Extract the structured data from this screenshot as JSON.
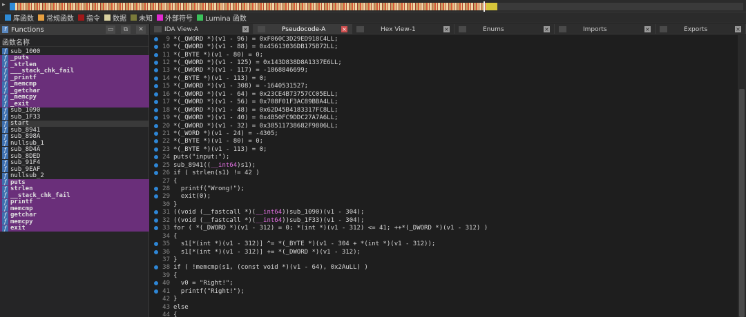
{
  "legend": [
    {
      "label": "库函数",
      "color": "#2e8bd6"
    },
    {
      "label": "常规函数",
      "color": "#e8a040"
    },
    {
      "label": "指令",
      "color": "#a01818"
    },
    {
      "label": "数据",
      "color": "#d8d0a0"
    },
    {
      "label": "未知",
      "color": "#7a7a3a"
    },
    {
      "label": "外部符号",
      "color": "#e02ad0"
    },
    {
      "label": "Lumina 函数",
      "color": "#3ac05a"
    }
  ],
  "functions_panel": {
    "title": "Functions",
    "column_header": "函数名称",
    "items": [
      {
        "name": "sub_1000",
        "kind": "regular"
      },
      {
        "name": "_puts",
        "kind": "lib"
      },
      {
        "name": "_strlen",
        "kind": "lib"
      },
      {
        "name": "___stack_chk_fail",
        "kind": "lib"
      },
      {
        "name": "_printf",
        "kind": "lib"
      },
      {
        "name": "_memcmp",
        "kind": "lib"
      },
      {
        "name": "_getchar",
        "kind": "lib"
      },
      {
        "name": "_memcpy",
        "kind": "lib"
      },
      {
        "name": "_exit",
        "kind": "lib"
      },
      {
        "name": "sub_1090",
        "kind": "regular"
      },
      {
        "name": "sub_1F33",
        "kind": "regular"
      },
      {
        "name": "start",
        "kind": "selected"
      },
      {
        "name": "sub_8941",
        "kind": "regular"
      },
      {
        "name": "sub_898A",
        "kind": "regular"
      },
      {
        "name": "nullsub_1",
        "kind": "regular"
      },
      {
        "name": "sub_8D4A",
        "kind": "regular"
      },
      {
        "name": "sub_8DED",
        "kind": "regular"
      },
      {
        "name": "sub_91F4",
        "kind": "regular"
      },
      {
        "name": "sub_9EAF",
        "kind": "regular"
      },
      {
        "name": "nullsub_2",
        "kind": "regular"
      },
      {
        "name": "puts",
        "kind": "extern"
      },
      {
        "name": "strlen",
        "kind": "extern"
      },
      {
        "name": "__stack_chk_fail",
        "kind": "extern"
      },
      {
        "name": "printf",
        "kind": "extern"
      },
      {
        "name": "memcmp",
        "kind": "extern"
      },
      {
        "name": "getchar",
        "kind": "extern"
      },
      {
        "name": "memcpy",
        "kind": "extern"
      },
      {
        "name": "exit",
        "kind": "extern"
      }
    ]
  },
  "tabs": [
    {
      "label": "IDA View-A",
      "icon": "ida-view-icon",
      "active": false
    },
    {
      "label": "Pseudocode-A",
      "icon": "pseudocode-icon",
      "active": true
    },
    {
      "label": "Hex View-1",
      "icon": "hex-view-icon",
      "active": false
    },
    {
      "label": "Enums",
      "icon": "enums-icon",
      "active": false
    },
    {
      "label": "Imports",
      "icon": "imports-icon",
      "active": false
    },
    {
      "label": "Exports",
      "icon": "exports-icon",
      "active": false
    }
  ],
  "code_lines": [
    {
      "n": "9",
      "dot": true,
      "text": "*(_QWORD *)(v1 - 96) = 0xF060C3D29ED918C4LL;"
    },
    {
      "n": "10",
      "dot": true,
      "text": "*(_QWORD *)(v1 - 88) = 0x45613036DB175B72LL;"
    },
    {
      "n": "11",
      "dot": true,
      "text": "*(_BYTE *)(v1 - 80) = 0;"
    },
    {
      "n": "12",
      "dot": true,
      "text": "*(_QWORD *)(v1 - 125) = 0x143D838D8A1337E6LL;"
    },
    {
      "n": "13",
      "dot": true,
      "text": "*(_DWORD *)(v1 - 117) = -1868846699;"
    },
    {
      "n": "14",
      "dot": true,
      "text": "*(_BYTE *)(v1 - 113) = 0;"
    },
    {
      "n": "15",
      "dot": true,
      "text": "*(_DWORD *)(v1 - 308) = -1640531527;"
    },
    {
      "n": "16",
      "dot": true,
      "text": "*(_QWORD *)(v1 - 64) = 0x23CE4B73757CC05ELL;"
    },
    {
      "n": "17",
      "dot": true,
      "text": "*(_QWORD *)(v1 - 56) = 0x708F01F3AC89BBA4LL;"
    },
    {
      "n": "18",
      "dot": true,
      "text": "*(_QWORD *)(v1 - 48) = 0x62D45B4183317FC8LL;"
    },
    {
      "n": "19",
      "dot": true,
      "text": "*(_QWORD *)(v1 - 40) = 0x4B50FC9DDC27A7A6LL;"
    },
    {
      "n": "20",
      "dot": true,
      "text": "*(_QWORD *)(v1 - 32) = 0x38511738682F9806LL;"
    },
    {
      "n": "21",
      "dot": true,
      "text": "*(_WORD *)(v1 - 24) = -4305;"
    },
    {
      "n": "22",
      "dot": true,
      "text": "*(_BYTE *)(v1 - 80) = 0;"
    },
    {
      "n": "23",
      "dot": true,
      "text": "*(_BYTE *)(v1 - 113) = 0;"
    },
    {
      "n": "24",
      "dot": true,
      "text": "puts(\"input:\");"
    },
    {
      "n": "25",
      "dot": true,
      "text": "sub_8941((__int64)s1);"
    },
    {
      "n": "26",
      "dot": true,
      "text": "if ( strlen(s1) != 42 )"
    },
    {
      "n": "27",
      "dot": false,
      "text": "{"
    },
    {
      "n": "28",
      "dot": true,
      "text": "  printf(\"Wrong!\");"
    },
    {
      "n": "29",
      "dot": true,
      "text": "  exit(0);"
    },
    {
      "n": "30",
      "dot": false,
      "text": "}"
    },
    {
      "n": "31",
      "dot": true,
      "text": "((void (__fastcall *)(__int64))sub_1090)(v1 - 304);"
    },
    {
      "n": "32",
      "dot": true,
      "text": "((void (__fastcall *)(__int64))sub_1F33)(v1 - 304);"
    },
    {
      "n": "33",
      "dot": true,
      "text": "for ( *(_DWORD *)(v1 - 312) = 0; *(int *)(v1 - 312) <= 41; ++*(_DWORD *)(v1 - 312) )"
    },
    {
      "n": "34",
      "dot": false,
      "text": "{"
    },
    {
      "n": "35",
      "dot": true,
      "text": "  s1[*(int *)(v1 - 312)] ^= *(_BYTE *)(v1 - 304 + *(int *)(v1 - 312));"
    },
    {
      "n": "36",
      "dot": true,
      "text": "  s1[*(int *)(v1 - 312)] += *(_DWORD *)(v1 - 312);"
    },
    {
      "n": "37",
      "dot": false,
      "text": "}"
    },
    {
      "n": "38",
      "dot": true,
      "text": "if ( !memcmp(s1, (const void *)(v1 - 64), 0x2AuLL) )"
    },
    {
      "n": "39",
      "dot": false,
      "text": "{"
    },
    {
      "n": "40",
      "dot": true,
      "text": "  v0 = \"Right!\";"
    },
    {
      "n": "41",
      "dot": true,
      "text": "  printf(\"Right!\");"
    },
    {
      "n": "42",
      "dot": false,
      "text": "}"
    },
    {
      "n": "43",
      "dot": false,
      "text": "else"
    },
    {
      "n": "44",
      "dot": false,
      "text": "{"
    }
  ],
  "colors": {
    "lib_function_bg": "#6a2f7a",
    "breakpoint_dot": "#2e86d6",
    "active_tab_close": "#d05050"
  }
}
